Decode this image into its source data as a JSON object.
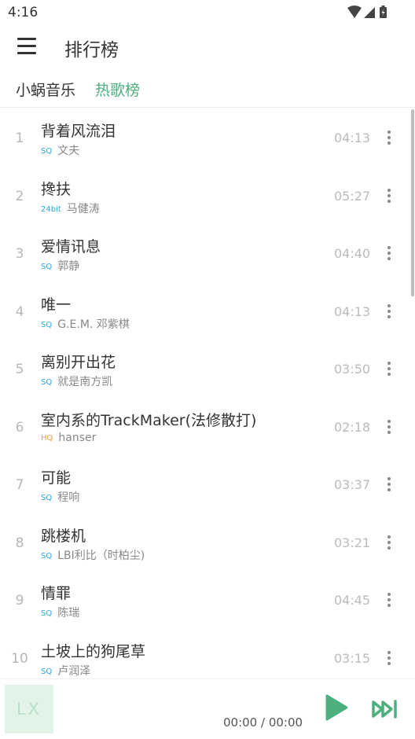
{
  "status_bar": {
    "time": "4:16"
  },
  "app_bar": {
    "title": "排行榜"
  },
  "tabs": [
    {
      "label": "小蜗音乐"
    },
    {
      "label": "热歌榜"
    }
  ],
  "songs": [
    {
      "index": "1",
      "title": "背着风流泪",
      "quality": "SQ",
      "artist": "文夫",
      "duration": "04:13"
    },
    {
      "index": "2",
      "title": "搀扶",
      "quality": "24bit",
      "artist": "马健涛",
      "duration": "05:27"
    },
    {
      "index": "3",
      "title": "爱情讯息",
      "quality": "SQ",
      "artist": "郭静",
      "duration": "04:40"
    },
    {
      "index": "4",
      "title": "唯一",
      "quality": "SQ",
      "artist": "G.E.M. 邓紫棋",
      "duration": "04:13"
    },
    {
      "index": "5",
      "title": "离别开出花",
      "quality": "SQ",
      "artist": "就是南方凯",
      "duration": "03:50"
    },
    {
      "index": "6",
      "title": "室内系的TrackMaker(法修散打)",
      "quality": "HQ",
      "artist": "hanser",
      "duration": "02:18"
    },
    {
      "index": "7",
      "title": "可能",
      "quality": "SQ",
      "artist": "程响",
      "duration": "03:37"
    },
    {
      "index": "8",
      "title": "跳楼机",
      "quality": "SQ",
      "artist": "LBI利比（时柏尘)",
      "duration": "03:21"
    },
    {
      "index": "9",
      "title": "情罪",
      "quality": "SQ",
      "artist": "陈瑞",
      "duration": "04:45"
    },
    {
      "index": "10",
      "title": "土坡上的狗尾草",
      "quality": "SQ",
      "artist": "卢润泽",
      "duration": "03:15"
    }
  ],
  "player": {
    "cover_text": "LX",
    "time": "00:00 / 00:00"
  },
  "colors": {
    "accent": "#4caf7d",
    "sq": "#2aa6e0",
    "hq": "#f0a030",
    "bit24": "#2aa6e0"
  },
  "icons": {
    "menu": "hamburger-icon",
    "more": "more-vertical-icon",
    "play": "play-icon",
    "next": "skip-next-icon",
    "wifi": "wifi-icon",
    "signal": "signal-icon",
    "battery": "battery-icon"
  }
}
